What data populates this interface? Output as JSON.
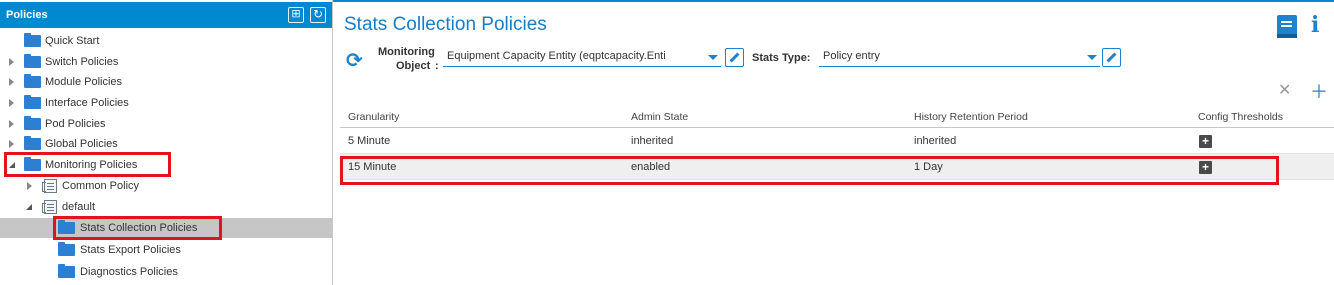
{
  "nav": {
    "title": "Policies",
    "items": [
      {
        "label": "Quick Start",
        "icon": "folder-icon",
        "expander": "none"
      },
      {
        "label": "Switch Policies",
        "icon": "folder-icon",
        "expander": "collapsed"
      },
      {
        "label": "Module Policies",
        "icon": "folder-icon",
        "expander": "collapsed"
      },
      {
        "label": "Interface Policies",
        "icon": "folder-icon",
        "expander": "collapsed"
      },
      {
        "label": "Pod Policies",
        "icon": "folder-icon",
        "expander": "collapsed"
      },
      {
        "label": "Global Policies",
        "icon": "folder-icon",
        "expander": "collapsed"
      },
      {
        "label": "Monitoring Policies",
        "icon": "folder-icon",
        "expander": "expanded"
      },
      {
        "label": "Common Policy",
        "icon": "policy-icon",
        "expander": "collapsed"
      },
      {
        "label": "default",
        "icon": "policy-icon",
        "expander": "expanded"
      },
      {
        "label": "Stats Collection Policies",
        "icon": "folder-icon",
        "expander": "none",
        "selected": true
      },
      {
        "label": "Stats Export Policies",
        "icon": "folder-icon",
        "expander": "none"
      },
      {
        "label": "Diagnostics Policies",
        "icon": "folder-icon",
        "expander": "none"
      }
    ]
  },
  "main": {
    "title": "Stats Collection Policies",
    "monitoring_object": {
      "label_line1": "Monitoring",
      "label_line2": "Object",
      "colon": ":",
      "value": "Equipment Capacity Entity (eqptcapacity.Enti"
    },
    "stats_type": {
      "label": "Stats Type:",
      "value": "Policy entry"
    },
    "table": {
      "columns": [
        "Granularity",
        "Admin State",
        "History Retention Period",
        "Config Thresholds"
      ],
      "rows": [
        {
          "granularity": "5 Minute",
          "admin_state": "inherited",
          "retention": "inherited",
          "thresholds": "+"
        },
        {
          "granularity": "15 Minute",
          "admin_state": "enabled",
          "retention": "1 Day",
          "thresholds": "+"
        }
      ]
    }
  },
  "colors": {
    "accent": "#0089d0",
    "highlight": "#e0141e",
    "selected_row": "#c6c6c6"
  }
}
